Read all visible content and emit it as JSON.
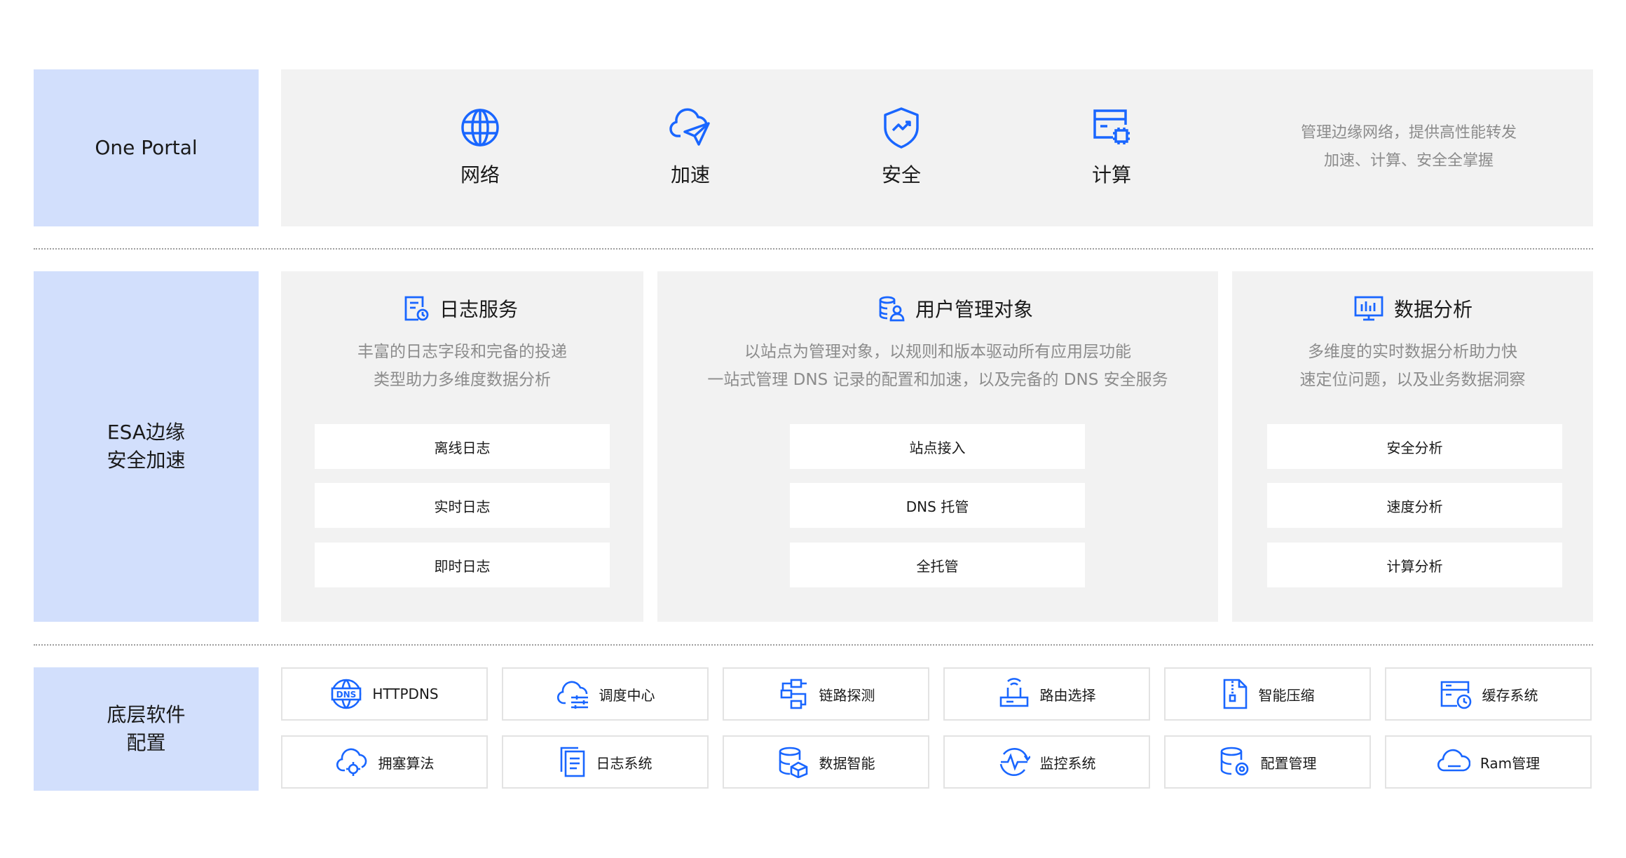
{
  "rows": {
    "portal": {
      "label": "One Portal",
      "items": [
        {
          "label": "网络",
          "icon": "globe-icon"
        },
        {
          "label": "加速",
          "icon": "cloud-paper-plane-icon"
        },
        {
          "label": "安全",
          "icon": "shield-check-icon"
        },
        {
          "label": "计算",
          "icon": "compute-chip-icon"
        }
      ],
      "description": [
        "管理边缘网络，提供高性能转发",
        "加速、计算、安全全掌握"
      ]
    },
    "esa": {
      "label": "ESA边缘\n安全加速",
      "panels": [
        {
          "title": "日志服务",
          "icon": "log-document-icon",
          "description": [
            "丰富的日志字段和完备的投递",
            "类型助力多维度数据分析"
          ],
          "items": [
            "离线日志",
            "实时日志",
            "即时日志"
          ]
        },
        {
          "title": "用户管理对象",
          "icon": "database-user-icon",
          "description": [
            "以站点为管理对象，以规则和版本驱动所有应用层功能",
            "一站式管理 DNS 记录的配置和加速，以及完备的 DNS 安全服务"
          ],
          "items": [
            "站点接入",
            "DNS 托管",
            "全托管"
          ]
        },
        {
          "title": "数据分析",
          "icon": "monitor-chart-icon",
          "description": [
            "多维度的实时数据分析助力快",
            "速定位问题，以及业务数据洞察"
          ],
          "items": [
            "安全分析",
            "速度分析",
            "计算分析"
          ]
        }
      ]
    },
    "base": {
      "label": "底层软件\n配置",
      "tiles": [
        {
          "label": "HTTPDNS",
          "icon": "dns-globe-icon"
        },
        {
          "label": "调度中心",
          "icon": "cloud-sliders-icon"
        },
        {
          "label": "链路探测",
          "icon": "link-nodes-icon"
        },
        {
          "label": "路由选择",
          "icon": "router-icon"
        },
        {
          "label": "智能压缩",
          "icon": "zip-file-icon"
        },
        {
          "label": "缓存系统",
          "icon": "cache-clock-icon"
        },
        {
          "label": "拥塞算法",
          "icon": "cloud-gear-icon"
        },
        {
          "label": "日志系统",
          "icon": "log-pages-icon"
        },
        {
          "label": "数据智能",
          "icon": "database-cube-icon"
        },
        {
          "label": "监控系统",
          "icon": "monitor-pulse-icon"
        },
        {
          "label": "配置管理",
          "icon": "database-gear-icon"
        },
        {
          "label": "Ram管理",
          "icon": "cloud-ram-icon"
        }
      ]
    }
  },
  "colors": {
    "accent": "#1966ff",
    "label_bg": "#d2dffc",
    "panel_bg": "#f2f2f2"
  }
}
